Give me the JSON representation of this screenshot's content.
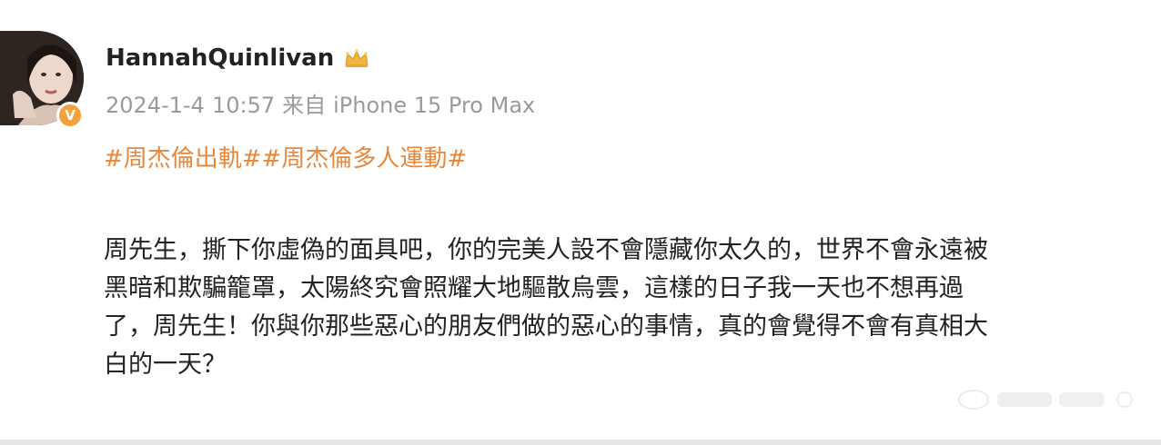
{
  "post": {
    "username": "HannahQuinlivan",
    "meta": {
      "date": "2024-1-4",
      "time": "10:57",
      "from_label": "来自",
      "device": "iPhone 15 Pro Max"
    },
    "hashtags": "#周杰倫出軌##周杰倫多人運動#",
    "content_lines": [
      "周先生，撕下你虛偽的面具吧，你的完美人設不會隱藏你太久的，世界不會永遠被",
      "黑暗和欺騙籠罩，太陽終究會照耀大地驅散烏雲，這樣的日子我一天也不想再過",
      "了，周先生！你與你那些惡心的朋友們做的惡心的事情，真的會覺得不會有真相大",
      "白的一天？"
    ]
  },
  "icons": {
    "avatar": "avatar-photo",
    "verified": "verified-v-badge",
    "crown": "crown-icon"
  },
  "colors": {
    "username": "#222222",
    "meta": "#9a9a9a",
    "hashtag": "#e8873a",
    "badge": "#f2a23a",
    "text": "#222222"
  }
}
